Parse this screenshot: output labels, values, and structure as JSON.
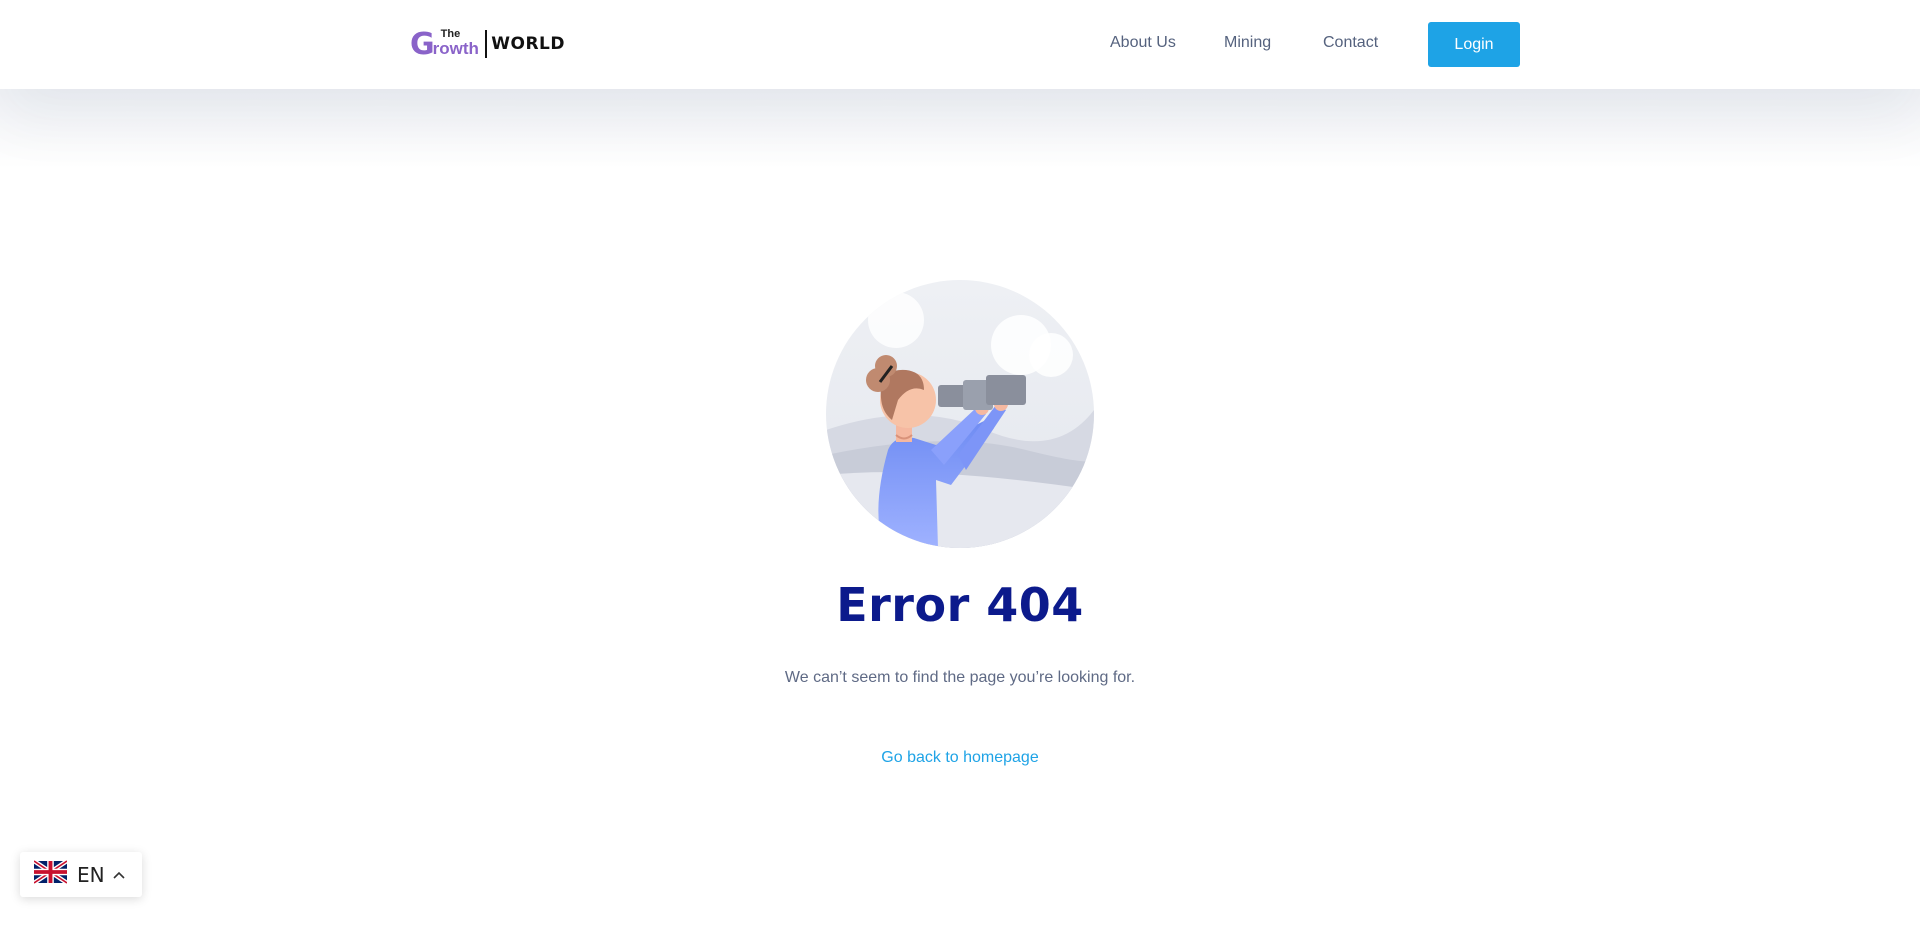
{
  "header": {
    "logo": {
      "the": "The",
      "growth": "rowth",
      "g": "G",
      "world": "WORLD"
    },
    "nav": [
      {
        "label": "About Us"
      },
      {
        "label": "Mining"
      },
      {
        "label": "Contact"
      }
    ],
    "login_label": "Login"
  },
  "main": {
    "illustration": "person-with-binoculars-illustration",
    "title": "Error 404",
    "message": "We can’t seem to find the page you’re looking for.",
    "home_link": "Go back to homepage"
  },
  "language_switcher": {
    "code": "EN",
    "flag_icon": "uk-flag-icon",
    "caret_icon": "chevron-up-icon"
  },
  "colors": {
    "accent": "#1ea3e6",
    "title": "#0c1a8c",
    "brand_purple": "#8a63c9"
  }
}
